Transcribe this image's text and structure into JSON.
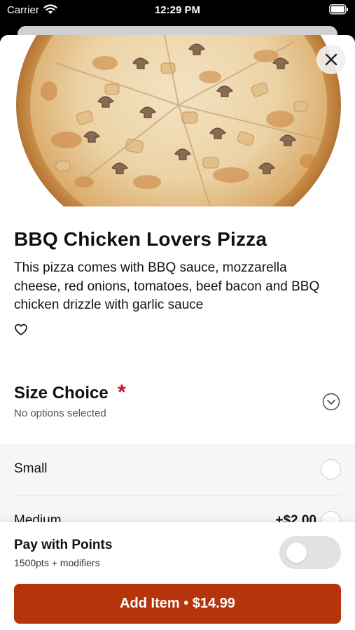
{
  "status_bar": {
    "carrier": "Carrier",
    "time": "12:29 PM"
  },
  "product": {
    "name": "BBQ Chicken Lovers Pizza",
    "description": "This pizza comes with BBQ sauce, mozzarella cheese, red onions, tomatoes, beef bacon and BBQ chicken drizzle with garlic sauce",
    "favorite": false
  },
  "size_choice": {
    "title": "Size Choice",
    "required_mark": "*",
    "subtitle": "No options selected",
    "options": [
      {
        "label": "Small",
        "price": "",
        "selected": false
      },
      {
        "label": "Medium",
        "price": "+$2.00",
        "selected": false
      }
    ]
  },
  "points": {
    "title": "Pay with Points",
    "subtitle": "1500pts + modifiers",
    "enabled": false
  },
  "add_button": {
    "label": "Add Item • $14.99"
  },
  "colors": {
    "accent": "#b5340c",
    "required": "#c8102e"
  }
}
